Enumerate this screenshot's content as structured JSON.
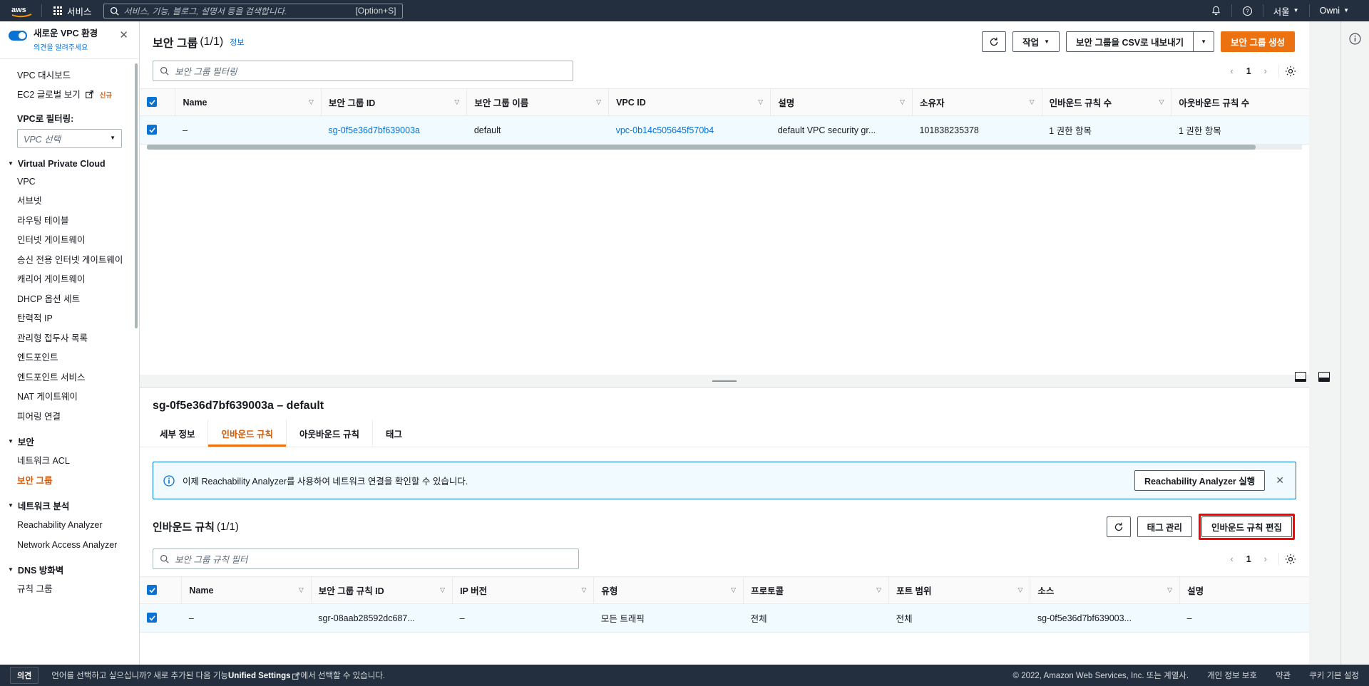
{
  "topnav": {
    "logo_alt": "aws",
    "services_label": "서비스",
    "search_placeholder": "서비스, 기능, 블로그, 설명서 등을 검색합니다.",
    "search_shortcut": "[Option+S]",
    "region_label": "서울",
    "account_label": "Owni"
  },
  "sidebar": {
    "banner_title": "새로운 VPC 환경",
    "banner_sub": "의견을 알려주세요",
    "dashboard": "VPC 대시보드",
    "global_view": "EC2 글로벌 보기",
    "global_view_badge": "신규",
    "filter_label": "VPC로 필터링:",
    "filter_value": "VPC 선택",
    "groups": [
      {
        "label": "Virtual Private Cloud",
        "items": [
          {
            "label": "VPC"
          },
          {
            "label": "서브넷"
          },
          {
            "label": "라우팅 테이블"
          },
          {
            "label": "인터넷 게이트웨이"
          },
          {
            "label": "송신 전용 인터넷 게이트웨이"
          },
          {
            "label": "캐리어 게이트웨이"
          },
          {
            "label": "DHCP 옵션 세트"
          },
          {
            "label": "탄력적 IP"
          },
          {
            "label": "관리형 접두사 목록"
          },
          {
            "label": "엔드포인트"
          },
          {
            "label": "엔드포인트 서비스"
          },
          {
            "label": "NAT 게이트웨이"
          },
          {
            "label": "피어링 연결"
          }
        ]
      },
      {
        "label": "보안",
        "items": [
          {
            "label": "네트워크 ACL"
          },
          {
            "label": "보안 그룹",
            "active": true
          }
        ]
      },
      {
        "label": "네트워크 분석",
        "items": [
          {
            "label": "Reachability Analyzer"
          },
          {
            "label": "Network Access Analyzer"
          }
        ]
      },
      {
        "label": "DNS 방화벽",
        "items": [
          {
            "label": "규칙 그룹"
          }
        ]
      }
    ]
  },
  "list_panel": {
    "title": "보안 그룹",
    "count": "(1/1)",
    "info_link": "정보",
    "refresh_icon": "refresh-icon",
    "actions_label": "작업",
    "export_label": "보안 그룹을 CSV로 내보내기",
    "create_label": "보안 그룹 생성",
    "filter_placeholder": "보안 그룹 필터링",
    "page_number": "1",
    "columns": [
      "Name",
      "보안 그룹 ID",
      "보안 그룹 이름",
      "VPC ID",
      "설명",
      "소유자",
      "인바운드 규칙 수",
      "아웃바운드 규칙 수"
    ],
    "rows": [
      {
        "name": "–",
        "group_id": "sg-0f5e36d7bf639003a",
        "group_name": "default",
        "vpc_id": "vpc-0b14c505645f570b4",
        "description": "default VPC security gr...",
        "owner": "101838235378",
        "inbound_count": "1 권한 항목",
        "outbound_count": "1 권한 항목"
      }
    ]
  },
  "detail_panel": {
    "title": "sg-0f5e36d7bf639003a – default",
    "tabs": [
      {
        "label": "세부 정보",
        "active": false
      },
      {
        "label": "인바운드 규칙",
        "active": true
      },
      {
        "label": "아웃바운드 규칙",
        "active": false
      },
      {
        "label": "태그",
        "active": false
      }
    ],
    "alert": {
      "message": "이제 Reachability Analyzer를 사용하여 네트워크 연결을 확인할 수 있습니다.",
      "button": "Reachability Analyzer 실행"
    },
    "rules": {
      "title": "인바운드 규칙",
      "count": "(1/1)",
      "manage_tags_label": "태그 관리",
      "edit_label": "인바운드 규칙 편집",
      "filter_placeholder": "보안 그룹 규칙 필터",
      "page_number": "1",
      "columns": [
        "Name",
        "보안 그룹 규칙 ID",
        "IP 버전",
        "유형",
        "프로토콜",
        "포트 범위",
        "소스",
        "설명"
      ],
      "rows": [
        {
          "name": "–",
          "rule_id": "sgr-08aab28592dc687...",
          "ip_version": "–",
          "type": "모든 트래픽",
          "protocol": "전체",
          "port_range": "전체",
          "source": "sg-0f5e36d7bf639003...",
          "description": "–"
        }
      ]
    }
  },
  "footer": {
    "feedback_label": "의견",
    "message_pre": "언어를 선택하고 싶으십니까? 새로 추가된 다음 기능",
    "message_link": "Unified Settings",
    "message_post": "에서 선택할 수 있습니다.",
    "copyright": "© 2022, Amazon Web Services, Inc. 또는 계열사.",
    "privacy": "개인 정보 보호",
    "terms": "약관",
    "cookies": "쿠키 기본 설정"
  },
  "colors": {
    "brand_orange": "#ec7211",
    "link_blue": "#0972d3",
    "nav_dark": "#232f3e",
    "highlight_red": "#ff0000"
  }
}
